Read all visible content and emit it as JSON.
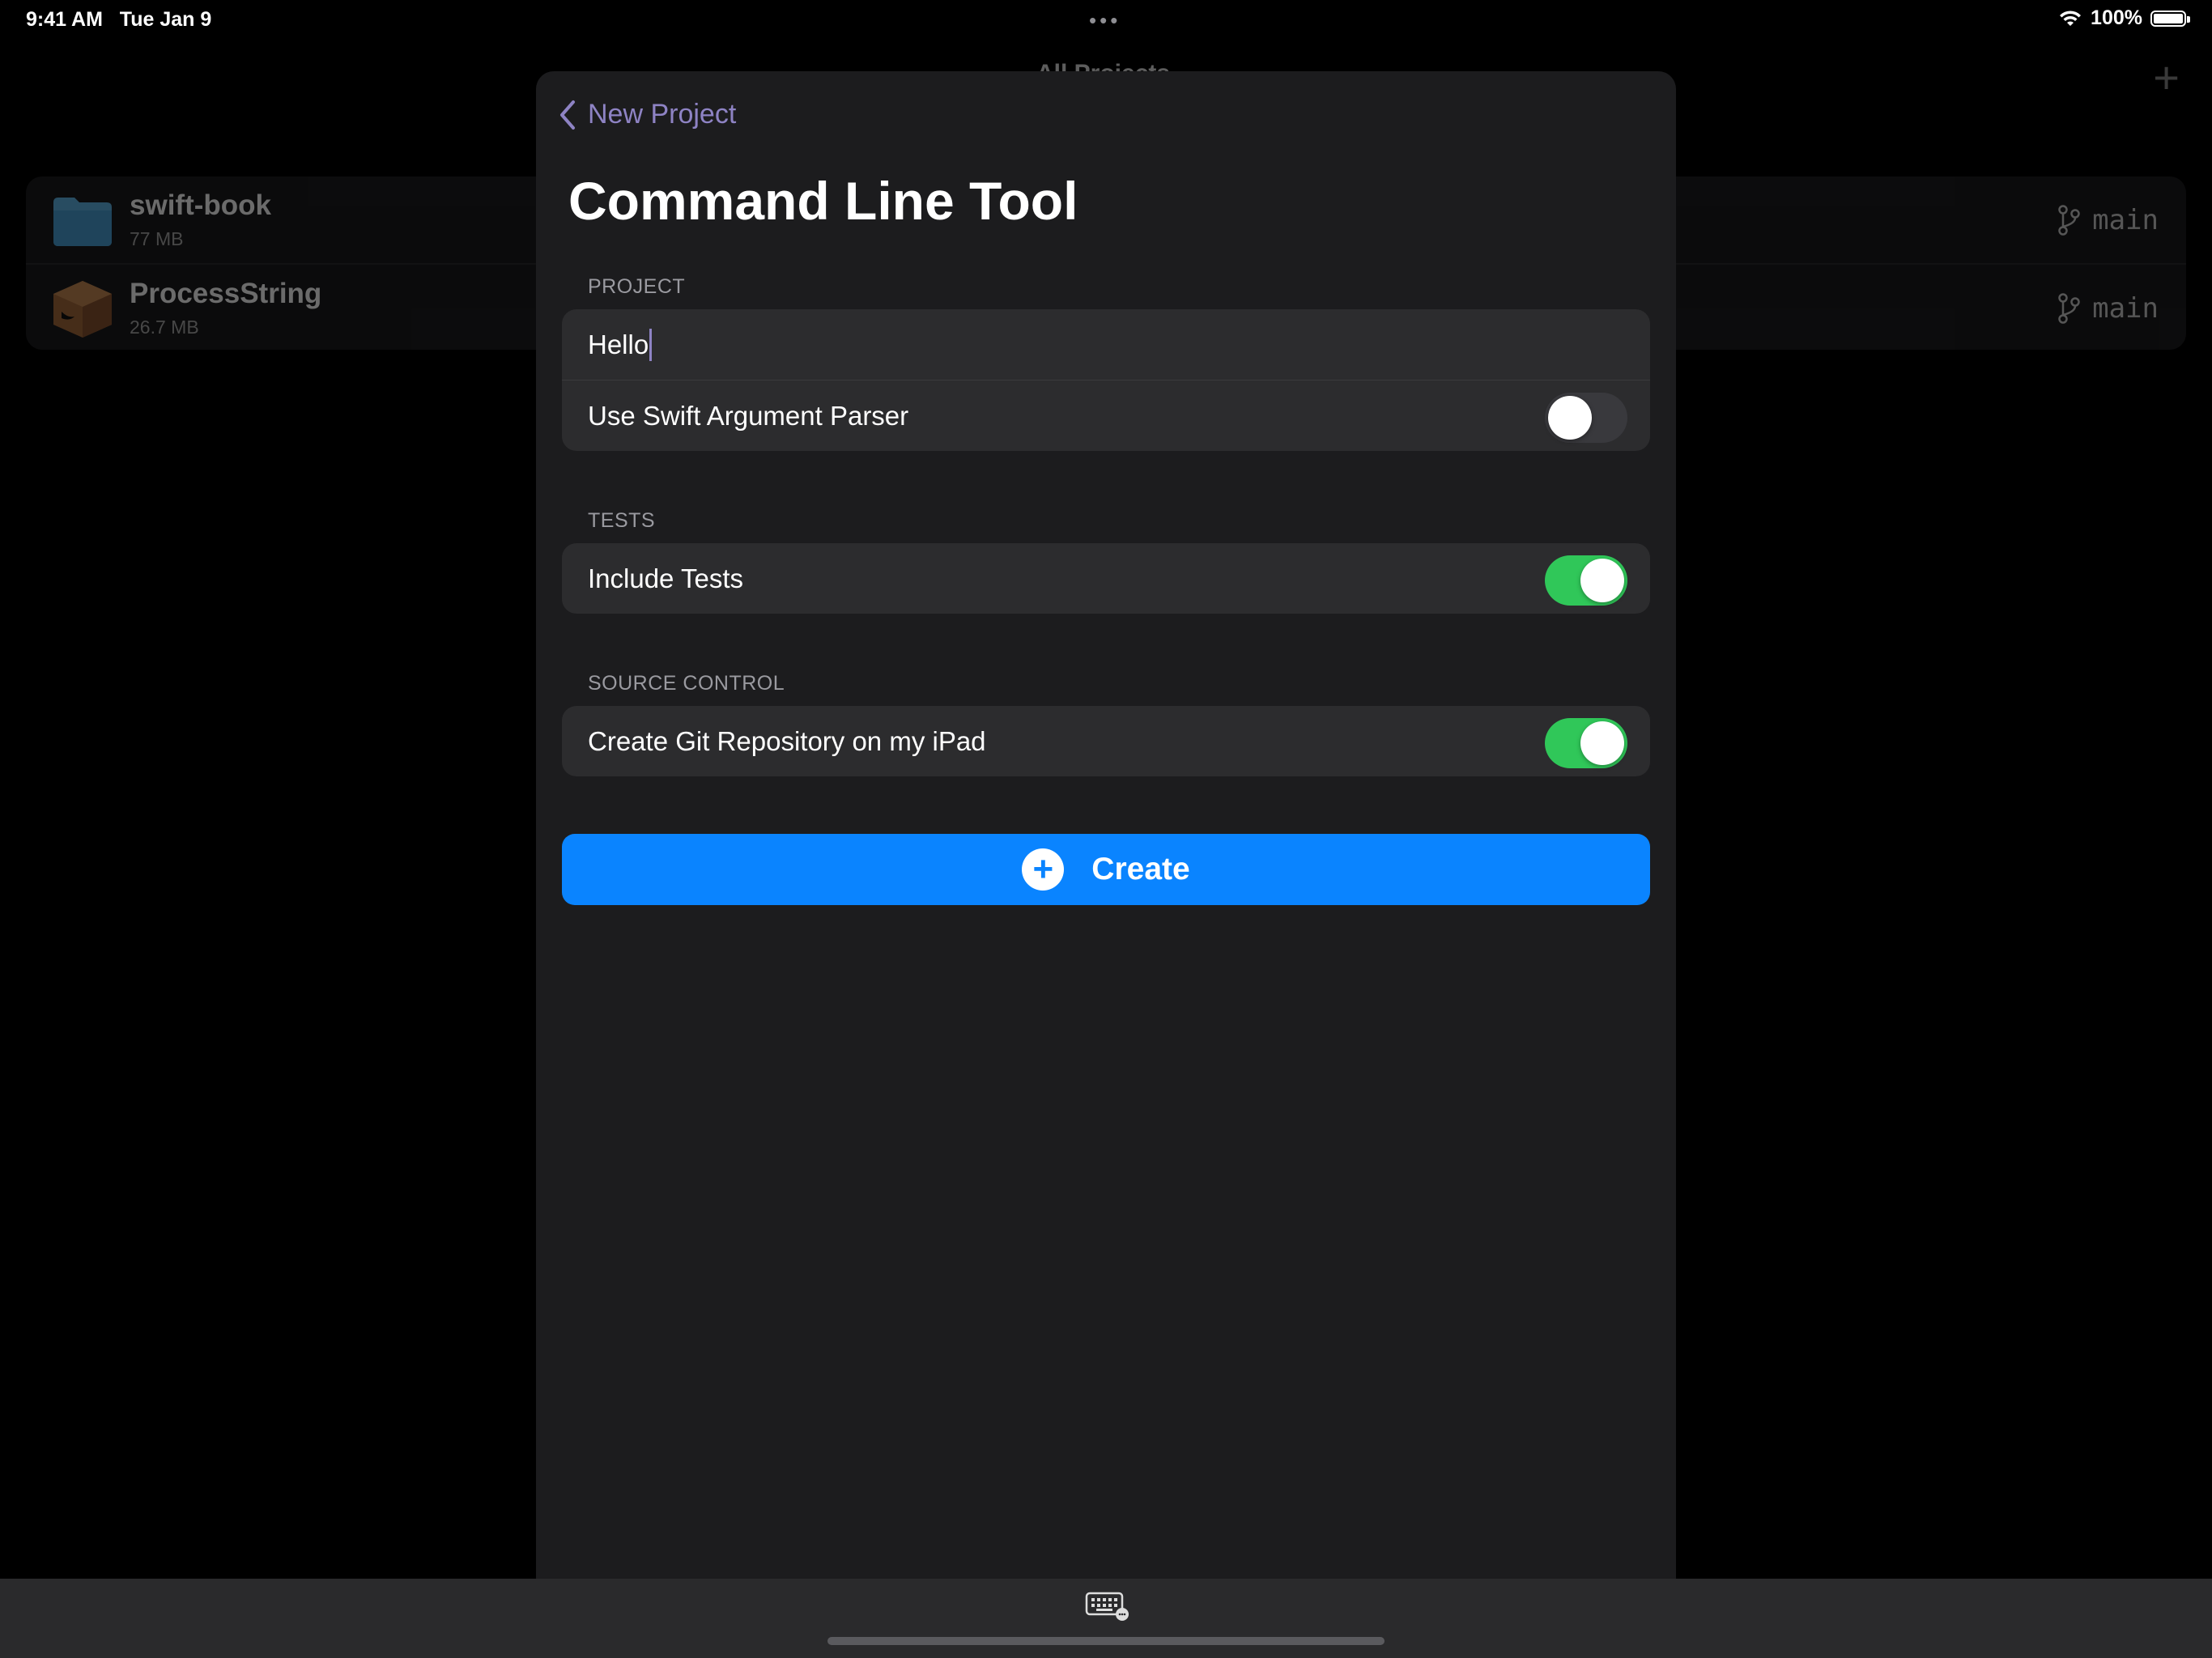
{
  "status_bar": {
    "time": "9:41 AM",
    "date": "Tue Jan 9",
    "battery": "100%"
  },
  "background": {
    "title": "All Projects",
    "projects": [
      {
        "name": "swift-book",
        "size": "77 MB",
        "branch": "main",
        "icon": "folder-icon"
      },
      {
        "name": "ProcessString",
        "size": "26.7 MB",
        "branch": "main",
        "icon": "swift-package-icon"
      }
    ]
  },
  "sheet": {
    "back_label": "New Project",
    "title": "Command Line Tool",
    "sections": {
      "project": {
        "header": "PROJECT",
        "name_value": "Hello",
        "argument_parser_label": "Use Swift Argument Parser",
        "argument_parser_on": false
      },
      "tests": {
        "header": "TESTS",
        "include_tests_label": "Include Tests",
        "include_tests_on": true
      },
      "source_control": {
        "header": "SOURCE CONTROL",
        "git_label": "Create Git Repository on my iPad",
        "git_on": true
      }
    },
    "create_label": "Create"
  },
  "colors": {
    "accent": "#8e83c4",
    "primary_button": "#0a84ff",
    "toggle_on": "#30c759"
  }
}
